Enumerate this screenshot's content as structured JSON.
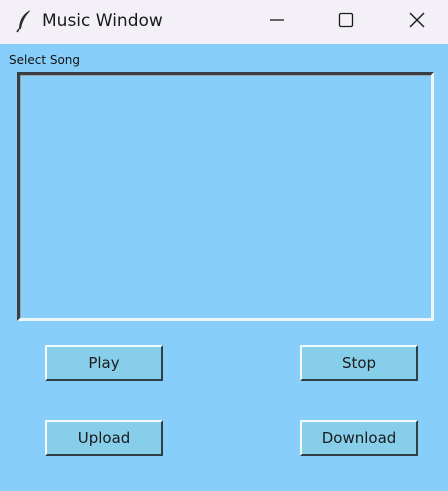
{
  "window": {
    "title": "Music Window",
    "icon": "feather-icon",
    "controls": {
      "minimize": "minimize-icon",
      "maximize": "maximize-icon",
      "close": "close-icon"
    }
  },
  "main": {
    "song_list_label": "Select Song",
    "song_list_items": [],
    "buttons": {
      "play": "Play",
      "stop": "Stop",
      "upload": "Upload",
      "download": "Download"
    }
  },
  "colors": {
    "background": "#87cefa",
    "titlebar": "#f3f0f7",
    "button": "#87ceeb"
  }
}
